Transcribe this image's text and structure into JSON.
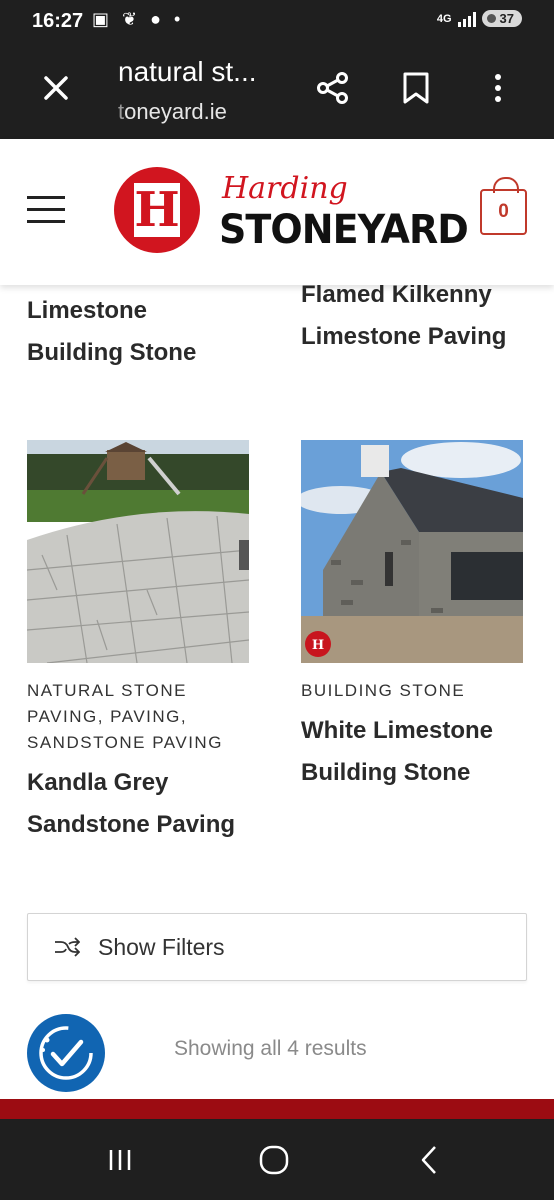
{
  "status_bar": {
    "time": "16:27",
    "network": "4G",
    "battery": "37"
  },
  "browser": {
    "page_title": "natural st...",
    "url_prefix": "t",
    "url_rest": "oneyard.ie"
  },
  "site": {
    "logo_script": "Harding",
    "logo_main": "STONEYARD",
    "logo_mark": "H",
    "cart_count": "0"
  },
  "products": [
    {
      "category": "",
      "title_line1": "Limestone",
      "title_line2": "Building Stone"
    },
    {
      "category": "",
      "title_line1": "Flamed Kilkenny",
      "title_line2": "Limestone Paving"
    },
    {
      "category_lines": [
        "NATURAL STONE",
        "PAVING, PAVING,",
        "SANDSTONE PAVING"
      ],
      "title_line1": "Kandla Grey",
      "title_line2": "Sandstone Paving",
      "image": "sandstone-patio"
    },
    {
      "category_lines": [
        "BUILDING STONE"
      ],
      "title_line1": "White Limestone",
      "title_line2": "Building Stone",
      "image": "stone-house"
    }
  ],
  "filters": {
    "label": "Show Filters",
    "icon": "shuffle-icon"
  },
  "results_text": "Showing all 4 results",
  "colors": {
    "brand_red": "#d1151f",
    "dark_red": "#9c0c12",
    "a11y_blue": "#1165b2",
    "chrome": "#1f1f1f"
  }
}
